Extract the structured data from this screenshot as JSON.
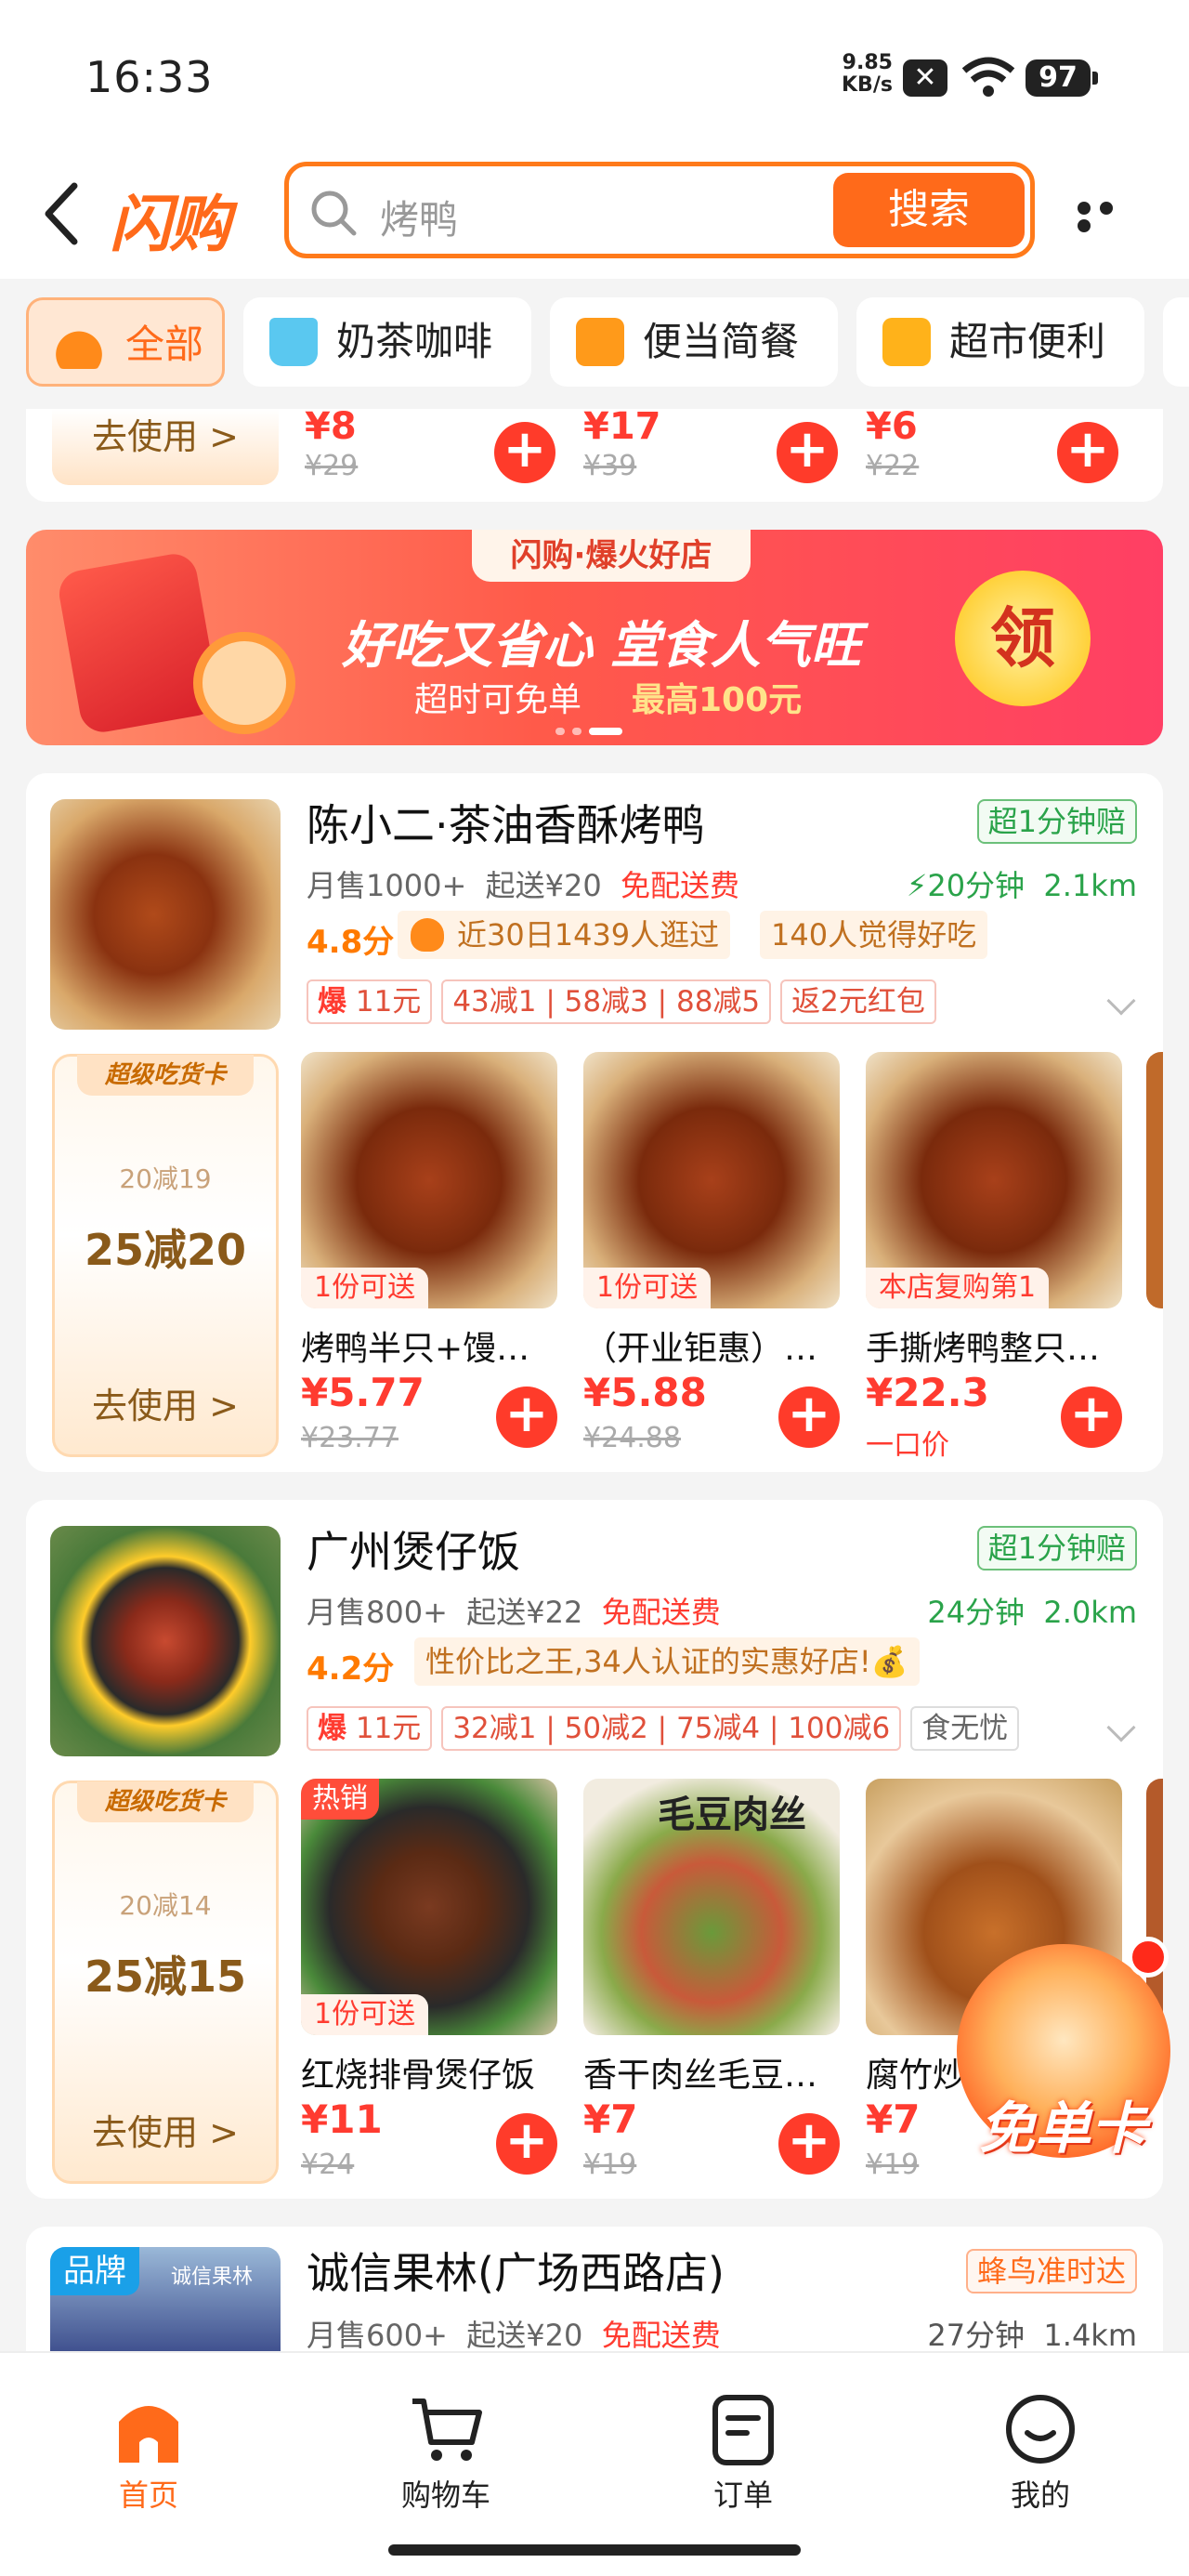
{
  "status_bar": {
    "time": "16:33",
    "speed_value": "9.85",
    "speed_unit": "KB/s",
    "battery": "97"
  },
  "header": {
    "logo": "闪购",
    "search_placeholder": "烤鸭",
    "search_button": "搜索"
  },
  "tabs": [
    {
      "label": "全部",
      "active": true
    },
    {
      "label": "奶茶咖啡"
    },
    {
      "label": "便当简餐"
    },
    {
      "label": "超市便利"
    }
  ],
  "top_strip": {
    "use_label": "去使用 >",
    "items": [
      {
        "price": "¥8",
        "original": "¥29"
      },
      {
        "price": "¥17",
        "original": "¥39"
      },
      {
        "price": "¥6",
        "original": "¥22"
      }
    ]
  },
  "banner": {
    "tag": "闪购·爆火好店",
    "headline": "好吃又省心 堂食人气旺",
    "sub_left": "超时可免单",
    "sub_right": "最高100元",
    "claim": "领"
  },
  "stores": [
    {
      "name": "陈小二·茶油香酥烤鸭",
      "guarantee": "超1分钟赔",
      "monthly_sales": "月售1000+",
      "min_order": "起送¥20",
      "delivery": "免配送费",
      "time": "20分钟",
      "distance": "2.1km",
      "score": "4.8分",
      "highlights": [
        "近30日1439人逛过",
        "140人觉得好吃"
      ],
      "promos": [
        {
          "label": "爆",
          "value": "11元"
        },
        {
          "label": "",
          "value": "43减1"
        },
        {
          "label": "",
          "value": "58减3"
        },
        {
          "label": "",
          "value": "88减5"
        },
        {
          "label": "",
          "value": "返2元红包"
        }
      ],
      "coupon": {
        "badge": "超级吃货卡",
        "small": "20减19",
        "big": "25减20",
        "use": "去使用 >"
      },
      "dishes": [
        {
          "tag": "1份可送",
          "name": "烤鸭半只+馒…",
          "price": "¥5.77",
          "original": "¥23.77"
        },
        {
          "tag": "1份可送",
          "name": "（开业钜惠）…",
          "price": "¥5.88",
          "original": "¥24.88"
        },
        {
          "tag": "本店复购第1",
          "name": "手撕烤鸭整只…",
          "price": "¥22.3",
          "original": "一口价"
        }
      ]
    },
    {
      "name": "广州煲仔饭",
      "guarantee": "超1分钟赔",
      "monthly_sales": "月售800+",
      "min_order": "起送¥22",
      "delivery": "免配送费",
      "time": "24分钟",
      "distance": "2.0km",
      "score": "4.2分",
      "highlights": [
        "性价比之王,34人认证的实惠好店!💰"
      ],
      "promos": [
        {
          "label": "爆",
          "value": "11元"
        },
        {
          "label": "",
          "value": "32减1"
        },
        {
          "label": "",
          "value": "50减2"
        },
        {
          "label": "",
          "value": "75减4"
        },
        {
          "label": "",
          "value": "100减6"
        },
        {
          "label": "",
          "value": "食无忧"
        }
      ],
      "coupon": {
        "badge": "超级吃货卡",
        "small": "20减14",
        "big": "25减15",
        "use": "去使用 >"
      },
      "dishes": [
        {
          "hot": "热销",
          "tag": "1份可送",
          "name": "红烧排骨煲仔饭",
          "price": "¥11",
          "original": "¥24"
        },
        {
          "overlay": "毛豆肉丝",
          "name": "香干肉丝毛豆…",
          "price": "¥7",
          "original": "¥19"
        },
        {
          "name": "腐竹炒…",
          "price": "¥7",
          "original": "¥19"
        }
      ]
    },
    {
      "name": "诚信果林(广场西路店)",
      "guarantee": "蜂鸟准时达",
      "brand": "品牌",
      "monthly_sales": "月售600+",
      "min_order": "起送¥20",
      "delivery": "免配送费",
      "time": "27分钟",
      "distance": "1.4km",
      "img_caption": "诚信果林"
    }
  ],
  "float_badge": "免单卡",
  "nav": [
    {
      "label": "首页",
      "active": true
    },
    {
      "label": "购物车"
    },
    {
      "label": "订单"
    },
    {
      "label": "我的"
    }
  ],
  "colors": {
    "brand": "#ff6a1a",
    "price": "#ff3b30",
    "green": "#2aa34a"
  }
}
